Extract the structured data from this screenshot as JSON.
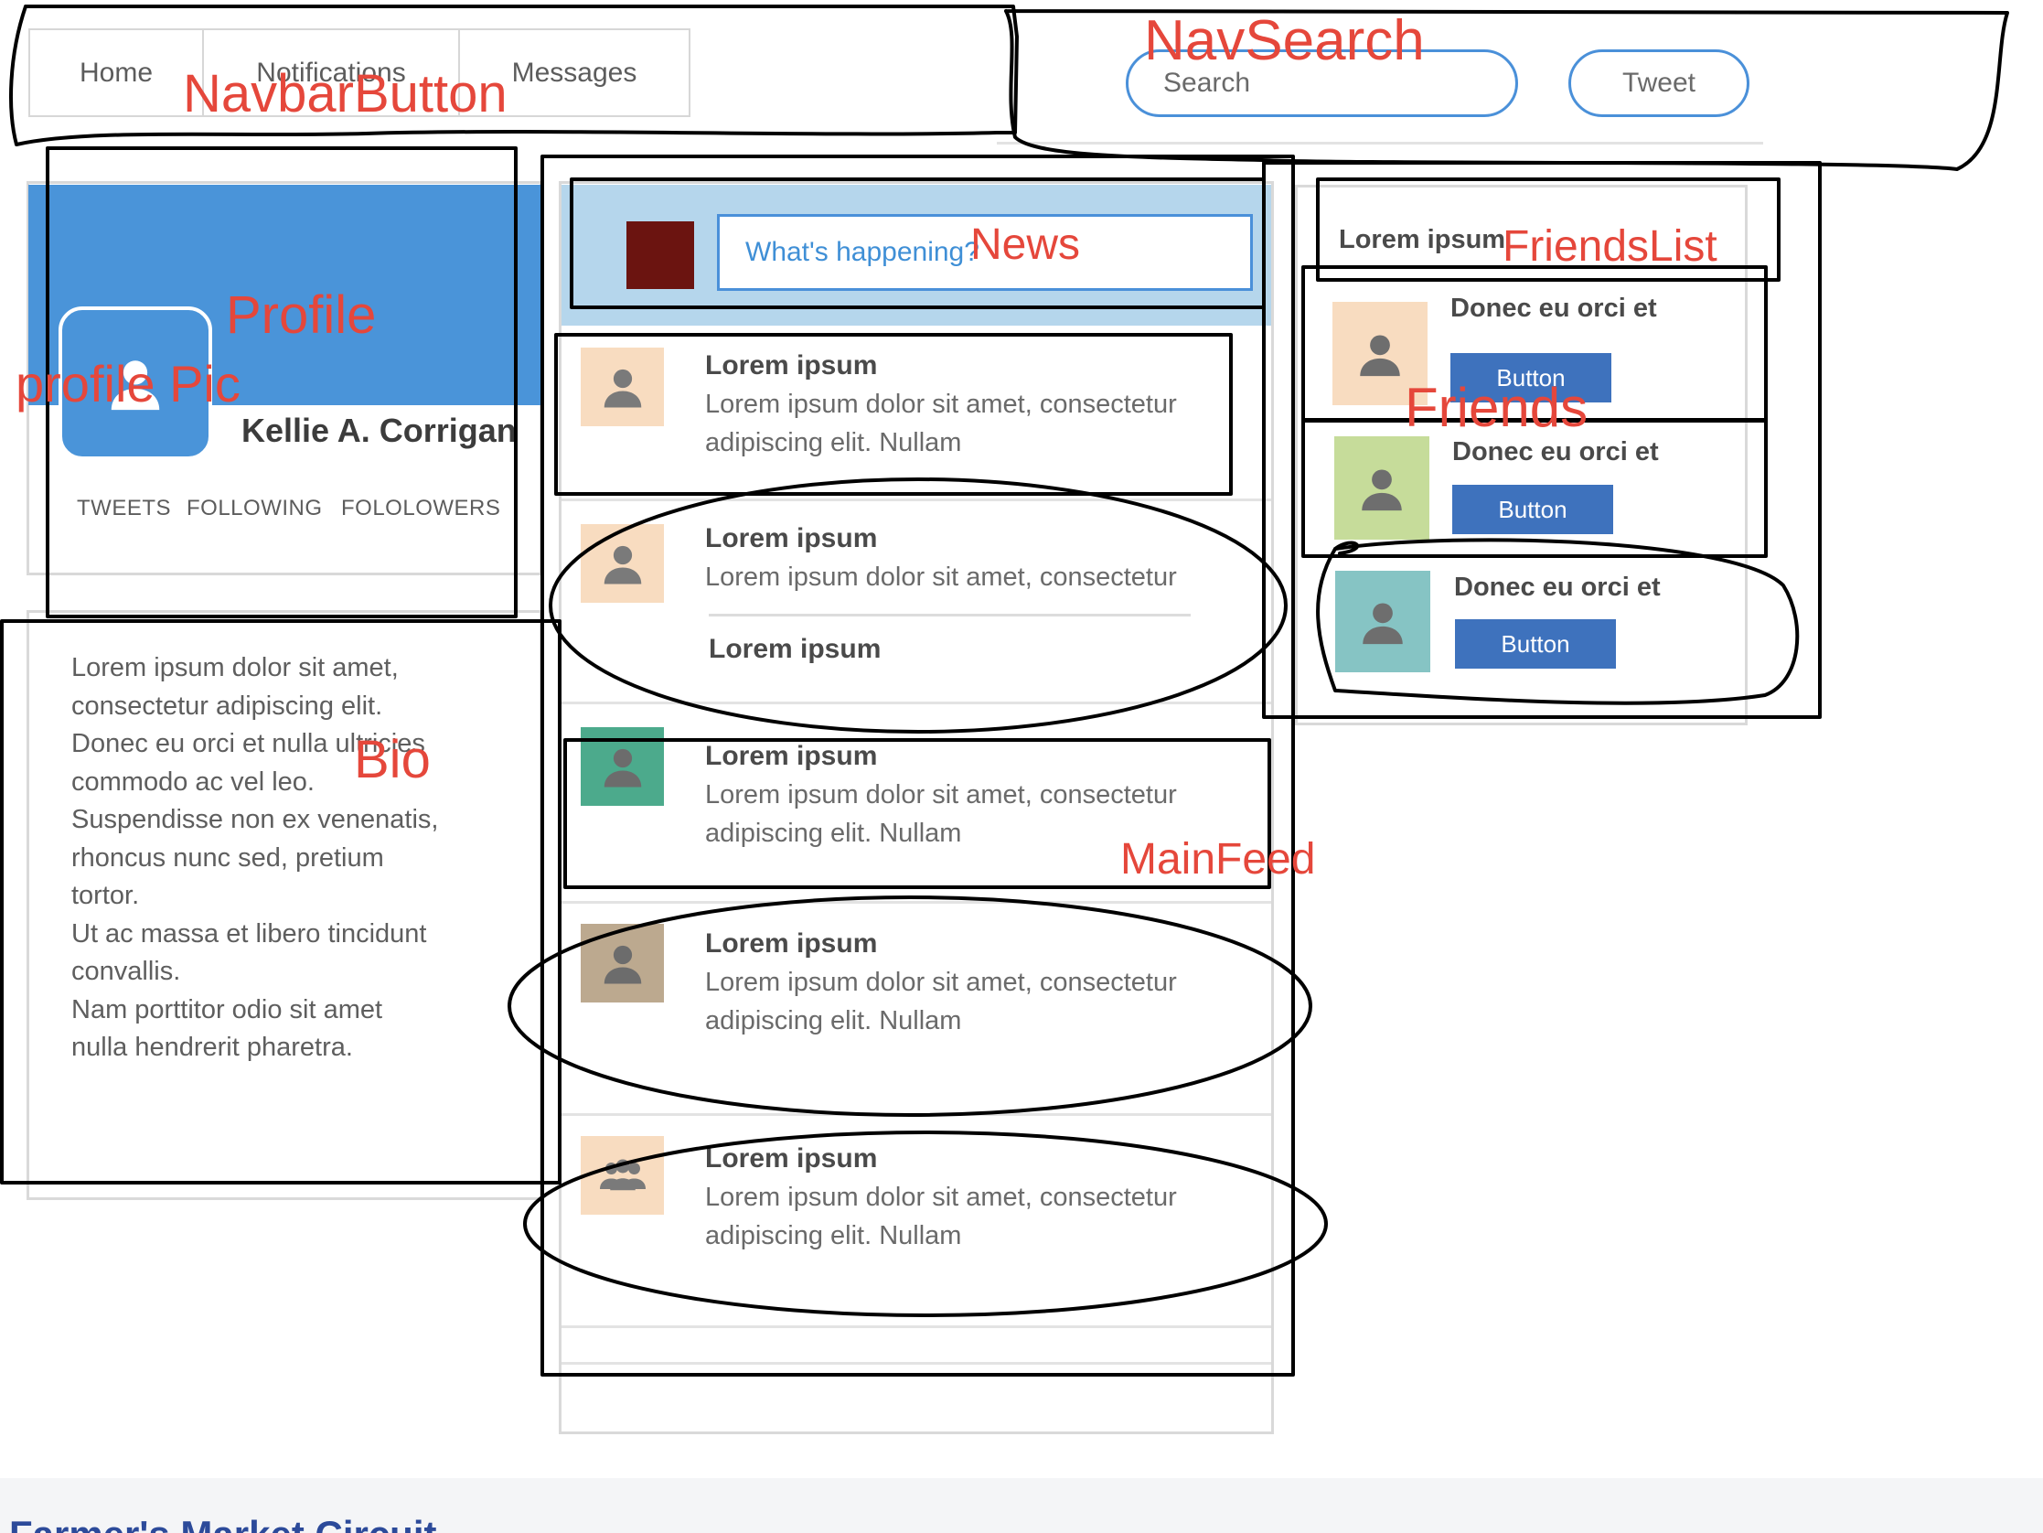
{
  "navbar": {
    "tabs": [
      {
        "label": "Home"
      },
      {
        "label": "Notifications"
      },
      {
        "label": "Messages"
      }
    ],
    "search_placeholder": "Search",
    "tweet_label": "Tweet"
  },
  "profile": {
    "name": "Kellie A. Corrigan",
    "stats": [
      {
        "label": "TWEETS"
      },
      {
        "label": "FOLLOWING"
      },
      {
        "label": "FOLOLOWERS"
      }
    ]
  },
  "bio": {
    "text": "Lorem ipsum dolor sit amet,\nconsectetur adipiscing elit.\nDonec eu orci et nulla ultricies\ncommodo ac vel leo.\nSuspendisse non ex venenatis,\nrhoncus nunc sed, pretium\ntortor.\nUt ac massa et libero tincidunt\nconvallis.\nNam porttitor odio sit amet\nnulla hendrerit pharetra."
  },
  "news": {
    "placeholder": "What's happening?"
  },
  "feed": {
    "items": [
      {
        "title": "Lorem ipsum",
        "text": "Lorem ipsum dolor sit amet, consectetur\nadipiscing elit. Nullam",
        "avatar_color": "#f8dcc0",
        "icon": "person-icon"
      },
      {
        "title": "Lorem ipsum",
        "text": "Lorem ipsum dolor sit amet, consectetur",
        "sub_title": "Lorem ipsum",
        "avatar_color": "#f8dcc0",
        "icon": "person-icon"
      },
      {
        "title": "Lorem ipsum",
        "text": "Lorem ipsum dolor sit amet, consectetur\nadipiscing elit. Nullam",
        "avatar_color": "#4caa8c",
        "icon": "person-icon"
      },
      {
        "title": "Lorem ipsum",
        "text": "Lorem ipsum dolor sit amet, consectetur\nadipiscing elit. Nullam",
        "avatar_color": "#bca98f",
        "icon": "person-icon"
      },
      {
        "title": "Lorem ipsum",
        "text": "Lorem ipsum dolor sit amet, consectetur\nadipiscing elit. Nullam",
        "avatar_color": "#f8dcc0",
        "icon": "group-icon"
      }
    ]
  },
  "friends": {
    "header": "Lorem ipsum",
    "items": [
      {
        "name": "Donec eu orci et",
        "button": "Button",
        "avatar_color": "#f8dcc0"
      },
      {
        "name": "Donec eu orci et",
        "button": "Button",
        "avatar_color": "#c6dc9a"
      },
      {
        "name": "Donec eu orci et",
        "button": "Button",
        "avatar_color": "#86c4c4"
      }
    ]
  },
  "annotations": {
    "navbar_button": "NavbarButton",
    "nav_search": "NavSearch",
    "profile": "Profile",
    "profile_pic": "profile Pic",
    "news": "News",
    "friends_list": "FriendsList",
    "friends": "Friends",
    "bio": "Bio",
    "main_feed": "MainFeed"
  },
  "footer": {
    "title": "Farmer's Market Circuit"
  },
  "colors": {
    "annotation_red": "#e5473b",
    "profile_blue": "#4a94d9",
    "news_bar": "#b5d6ec",
    "friend_button": "#3e72bd"
  }
}
